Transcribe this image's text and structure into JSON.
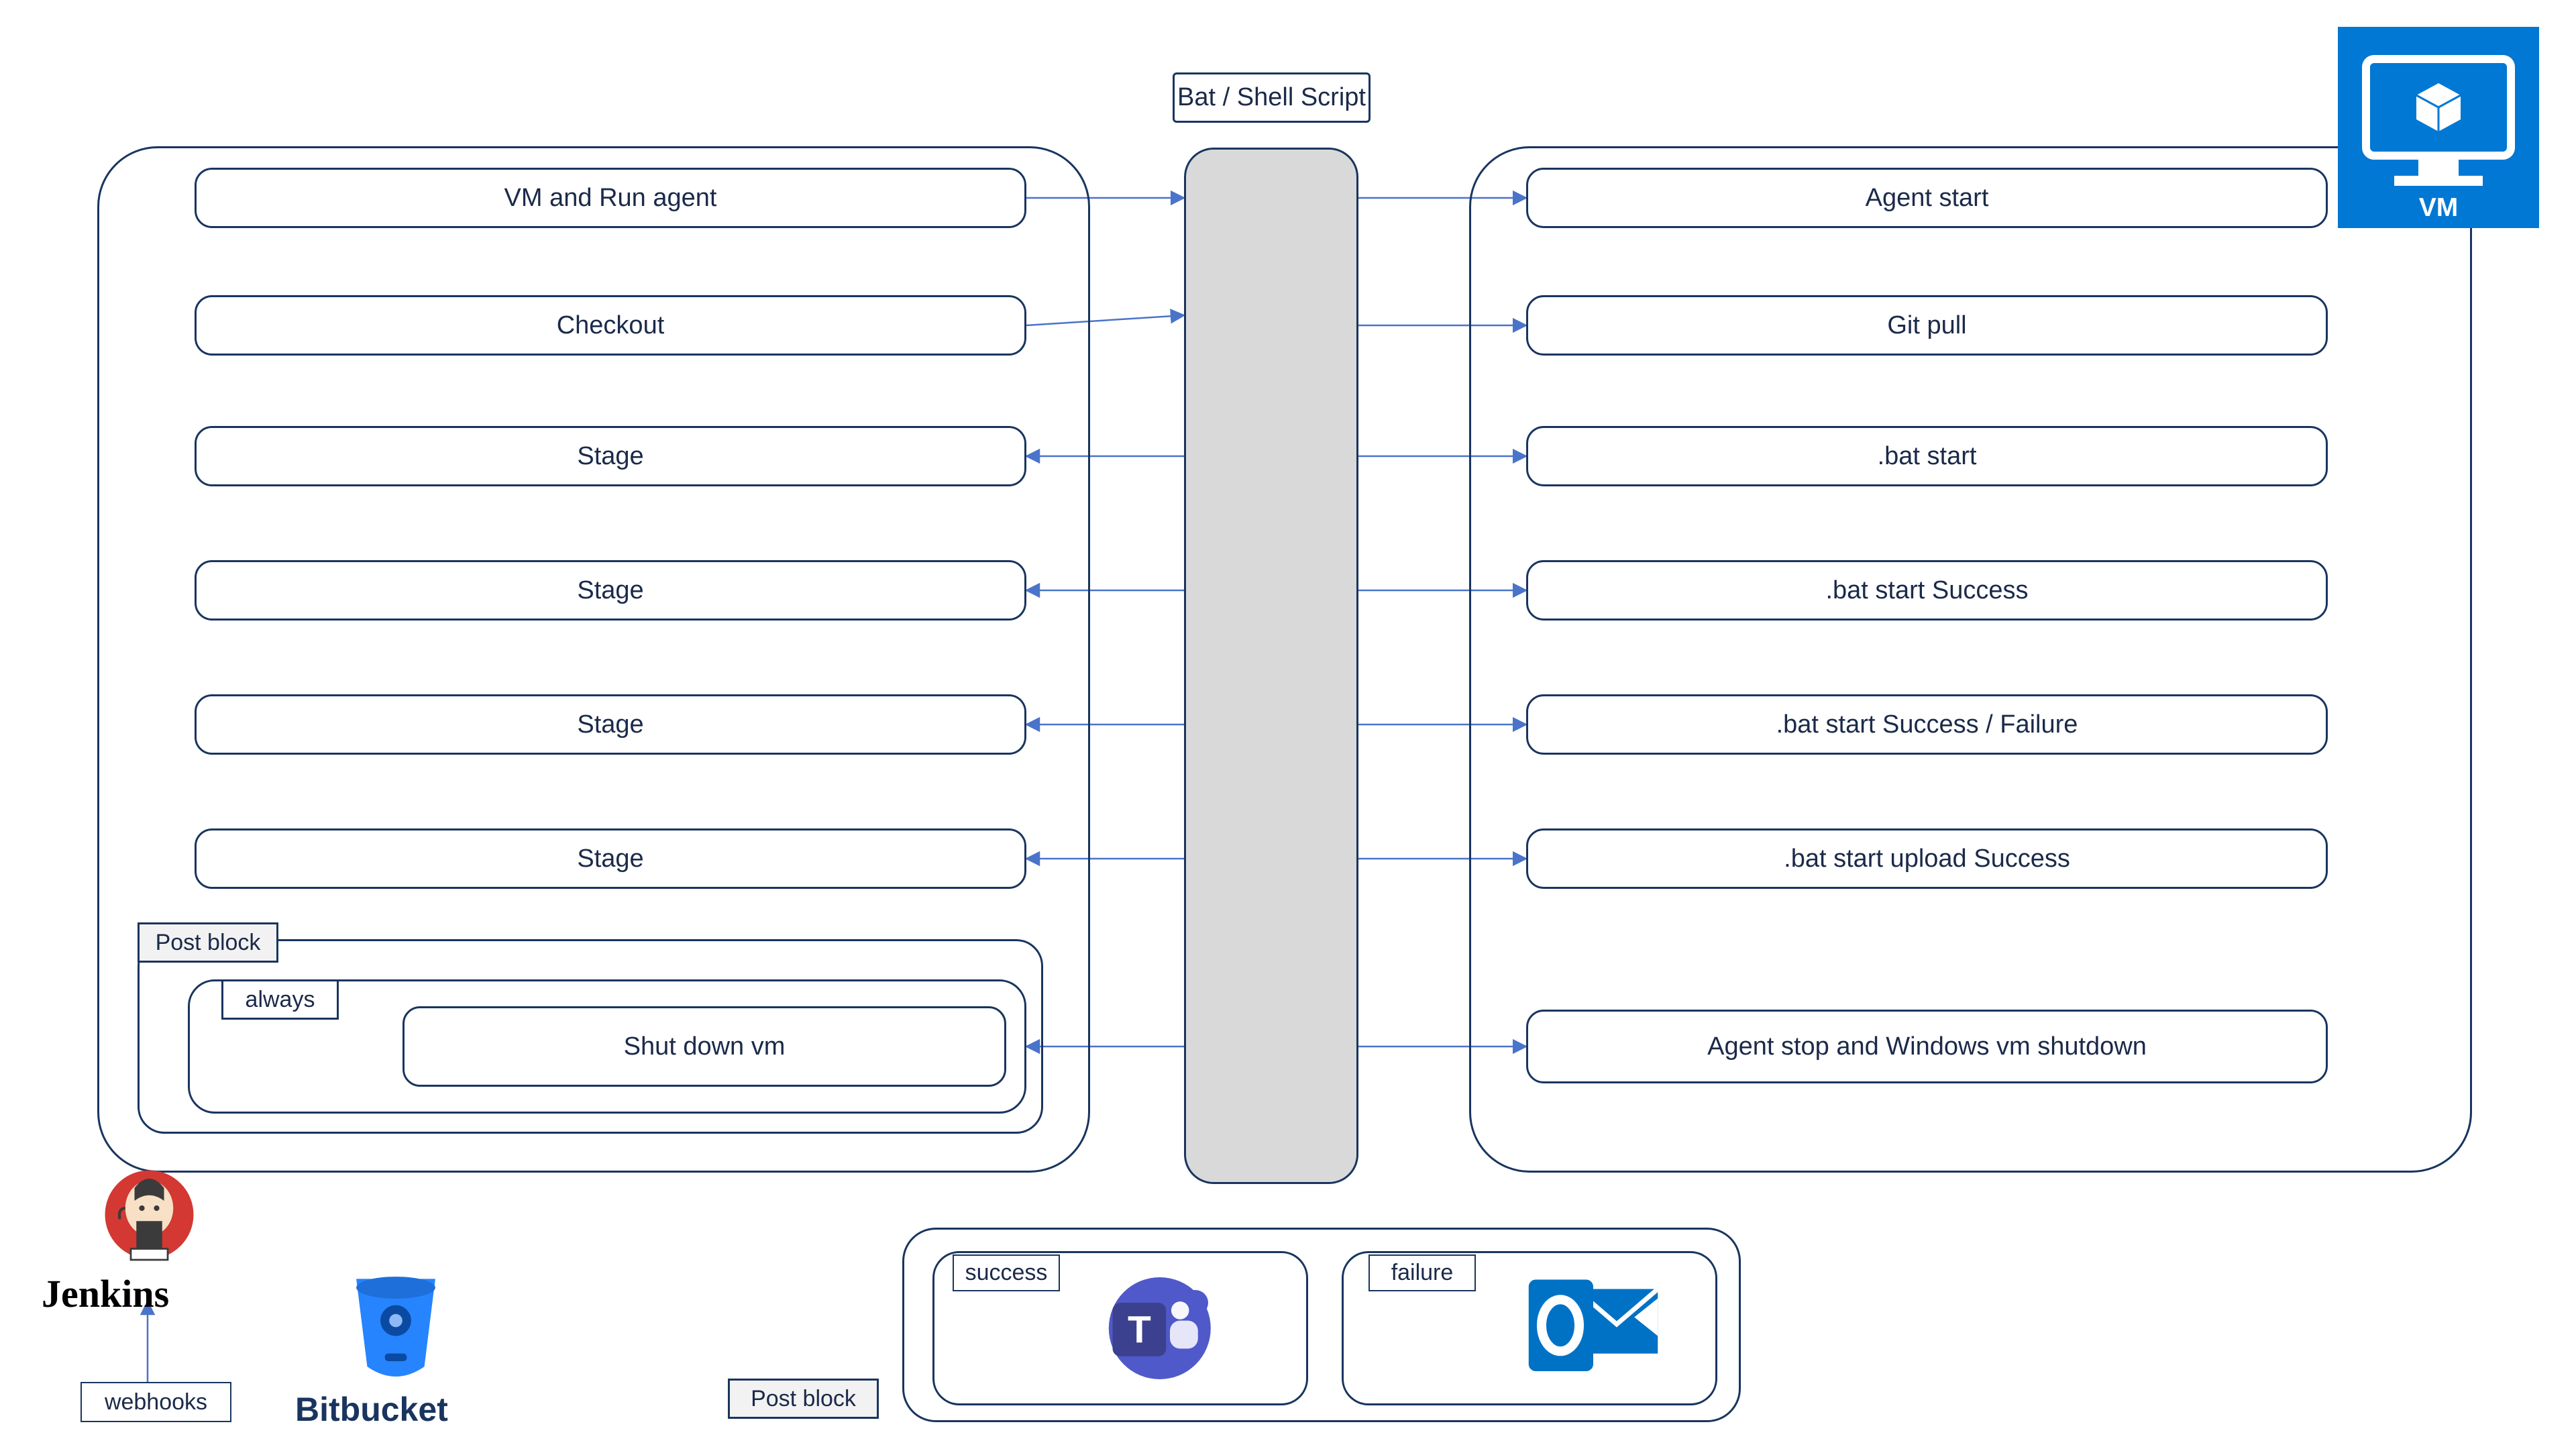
{
  "header": {
    "script_title": "Bat / Shell Script"
  },
  "left_panel": {
    "boxes": [
      "VM and Run agent",
      "Checkout",
      "Stage",
      "Stage",
      "Stage",
      "Stage"
    ],
    "post_block_label": "Post block",
    "always_label": "always",
    "shutdown": "Shut down vm"
  },
  "right_panel": {
    "boxes": [
      "Agent start",
      "Git pull",
      ".bat start",
      ".bat start Success",
      ".bat start Success / Failure",
      ".bat start upload Success",
      "Agent stop and Windows vm shutdown"
    ]
  },
  "bottom": {
    "post_block_label": "Post block",
    "success_label": "success",
    "failure_label": "failure"
  },
  "footer": {
    "jenkins": "Jenkins",
    "bitbucket": "Bitbucket",
    "vm": "VM",
    "webhooks": "webhooks"
  },
  "colors": {
    "border": "#19355f",
    "arrow": "#4a74c9",
    "script_fill": "#d9d9d9",
    "azure_blue": "#0078d4",
    "teams_purple": "#5059c9",
    "outlook_blue": "#0072c6",
    "bitbucket_blue": "#2684ff",
    "jenkins_red": "#d33833"
  }
}
